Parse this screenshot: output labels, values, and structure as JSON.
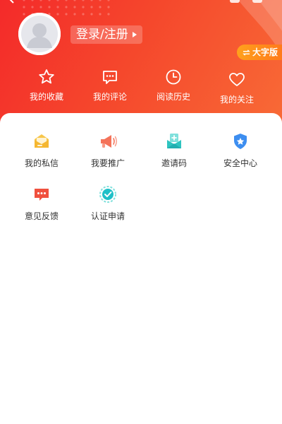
{
  "profile": {
    "login_label": "登录/注册",
    "big_font_label": "大字版"
  },
  "quick_links": [
    {
      "label": "我的收藏",
      "icon": "star-icon"
    },
    {
      "label": "我的评论",
      "icon": "comment-icon"
    },
    {
      "label": "阅读历史",
      "icon": "clock-icon"
    },
    {
      "label": "我的关注",
      "icon": "heart-icon"
    }
  ],
  "services": [
    {
      "label": "我的私信",
      "icon": "envelope-icon",
      "color": "#f5b731"
    },
    {
      "label": "我要推广",
      "icon": "megaphone-icon",
      "color": "#f4735a"
    },
    {
      "label": "邀请码",
      "icon": "invite-icon",
      "color": "#2ec4c0"
    },
    {
      "label": "安全中心",
      "icon": "shield-icon",
      "color": "#3d8ef0"
    },
    {
      "label": "意见反馈",
      "icon": "feedback-icon",
      "color": "#f0503e"
    },
    {
      "label": "认证申请",
      "icon": "verify-icon",
      "color": "#1fc0c8"
    }
  ],
  "colors": {
    "header_start": "#f42a2a",
    "header_end": "#f86a36",
    "big_font_badge": "#ff8a1c"
  }
}
